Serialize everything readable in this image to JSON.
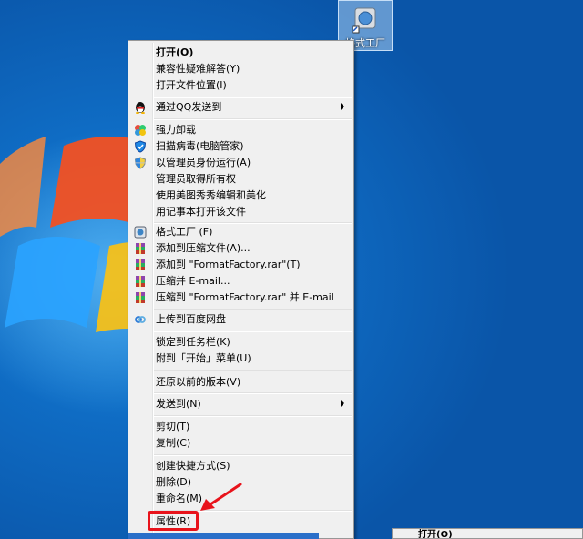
{
  "desktop": {
    "icon_label": "格式工厂"
  },
  "context_menu": {
    "items": [
      {
        "label": "打开(O)",
        "icon": "",
        "submenu": false,
        "bold": true
      },
      {
        "label": "兼容性疑难解答(Y)",
        "icon": "",
        "submenu": false
      },
      {
        "label": "打开文件位置(I)",
        "icon": "",
        "submenu": false
      },
      {
        "label": "通过QQ发送到",
        "icon": "qq-penguin-icon",
        "submenu": true
      },
      {
        "label": "强力卸载",
        "icon": "uninstall-icon",
        "submenu": false
      },
      {
        "label": "扫描病毒(电脑管家)",
        "icon": "shield-scan-icon",
        "submenu": false
      },
      {
        "label": "以管理员身份运行(A)",
        "icon": "uac-shield-icon",
        "submenu": false
      },
      {
        "label": "管理员取得所有权",
        "icon": "",
        "submenu": false
      },
      {
        "label": "使用美图秀秀编辑和美化",
        "icon": "",
        "submenu": false
      },
      {
        "label": "用记事本打开该文件",
        "icon": "",
        "submenu": false
      },
      {
        "label": "格式工厂 (F)",
        "icon": "formatfactory-icon",
        "submenu": false
      },
      {
        "label": "添加到压缩文件(A)...",
        "icon": "winrar-icon",
        "submenu": false
      },
      {
        "label": "添加到 \"FormatFactory.rar\"(T)",
        "icon": "winrar-icon",
        "submenu": false
      },
      {
        "label": "压缩并 E-mail...",
        "icon": "winrar-icon",
        "submenu": false
      },
      {
        "label": "压缩到 \"FormatFactory.rar\" 并 E-mail",
        "icon": "winrar-icon",
        "submenu": false
      },
      {
        "label": "上传到百度网盘",
        "icon": "baidu-cloud-icon",
        "submenu": false
      },
      {
        "label": "锁定到任务栏(K)",
        "icon": "",
        "submenu": false
      },
      {
        "label": "附到「开始」菜单(U)",
        "icon": "",
        "submenu": false
      },
      {
        "label": "还原以前的版本(V)",
        "icon": "",
        "submenu": false
      },
      {
        "label": "发送到(N)",
        "icon": "",
        "submenu": true
      },
      {
        "label": "剪切(T)",
        "icon": "",
        "submenu": false
      },
      {
        "label": "复制(C)",
        "icon": "",
        "submenu": false
      },
      {
        "label": "创建快捷方式(S)",
        "icon": "",
        "submenu": false
      },
      {
        "label": "删除(D)",
        "icon": "",
        "submenu": false
      },
      {
        "label": "重命名(M)",
        "icon": "",
        "submenu": false
      },
      {
        "label": "属性(R)",
        "icon": "",
        "submenu": false
      }
    ]
  },
  "mini_menu": {
    "first_item": "打开(O)"
  },
  "colors": {
    "highlight_red": "#e8131b",
    "menu_bg": "#f0f0f0"
  }
}
